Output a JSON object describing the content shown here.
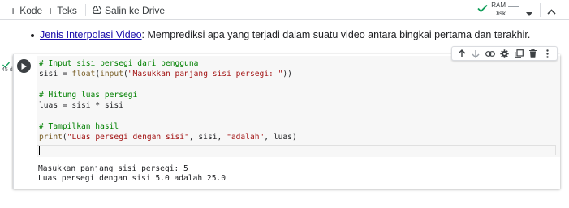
{
  "toolbar": {
    "add_code": "Kode",
    "add_text": "Teks",
    "save_drive": "Salin ke Drive",
    "ram_label": "RAM",
    "disk_label": "Disk"
  },
  "text_cell": {
    "link_text": "Jenis Interpolasi Video",
    "body_text": ": Memprediksi apa yang terjadi dalam suatu video antara bingkai pertama dan terakhir."
  },
  "exec": {
    "time": "45 d"
  },
  "code": {
    "l1_comment": "# Input sisi persegi dari pengguna",
    "l2_a": "sisi = ",
    "l2_fn1": "float",
    "l2_b": "(",
    "l2_fn2": "input",
    "l2_c": "(",
    "l2_str": "\"Masukkan panjang sisi persegi: \"",
    "l2_d": "))",
    "l4_comment": "# Hitung luas persegi",
    "l5": "luas = sisi * sisi",
    "l7_comment": "# Tampilkan hasil",
    "l8_fn": "print",
    "l8_a": "(",
    "l8_str1": "\"Luas persegi dengan sisi\"",
    "l8_b": ", sisi, ",
    "l8_str2": "\"adalah\"",
    "l8_c": ", luas)"
  },
  "output": {
    "line1": "Masukkan panjang sisi persegi: 5",
    "line2": "Luas persegi dengan sisi 5.0 adalah 25.0"
  },
  "colors": {
    "comment": "#008000",
    "string": "#a31515",
    "function": "#795e26",
    "link": "#1a0dab",
    "success": "#0f9d58"
  }
}
